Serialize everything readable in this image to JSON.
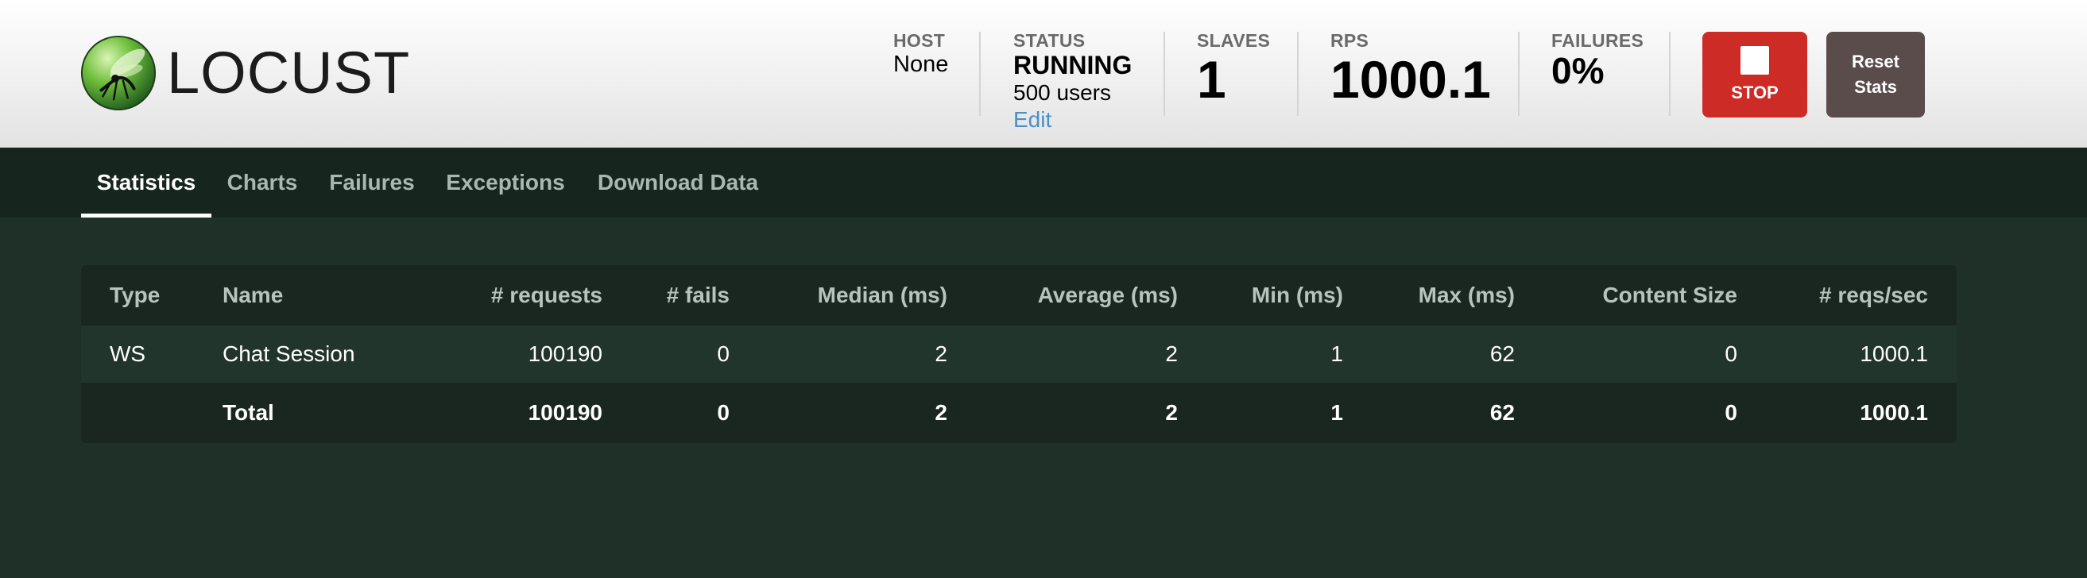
{
  "app": {
    "logo_text": "LOCUST"
  },
  "header": {
    "host": {
      "label": "HOST",
      "value": "None"
    },
    "status": {
      "label": "STATUS",
      "value": "RUNNING",
      "users": "500 users",
      "edit": "Edit"
    },
    "slaves": {
      "label": "SLAVES",
      "value": "1"
    },
    "rps": {
      "label": "RPS",
      "value": "1000.1"
    },
    "failures": {
      "label": "FAILURES",
      "value": "0%"
    },
    "stop_label": "STOP",
    "reset_label": "Reset Stats"
  },
  "tabs": [
    {
      "label": "Statistics",
      "active": true
    },
    {
      "label": "Charts"
    },
    {
      "label": "Failures"
    },
    {
      "label": "Exceptions"
    },
    {
      "label": "Download Data"
    }
  ],
  "table": {
    "columns": [
      "Type",
      "Name",
      "# requests",
      "# fails",
      "Median (ms)",
      "Average (ms)",
      "Min (ms)",
      "Max (ms)",
      "Content Size",
      "# reqs/sec"
    ],
    "rows": [
      [
        "WS",
        "Chat Session",
        "100190",
        "0",
        "2",
        "2",
        "1",
        "62",
        "0",
        "1000.1"
      ]
    ],
    "total": [
      "",
      "Total",
      "100190",
      "0",
      "2",
      "2",
      "1",
      "62",
      "0",
      "1000.1"
    ]
  },
  "colors": {
    "stop_button": "#cc2c25",
    "reset_button": "#5b4c4c",
    "edit_link": "#4a90c8",
    "background": "#1f3029"
  }
}
